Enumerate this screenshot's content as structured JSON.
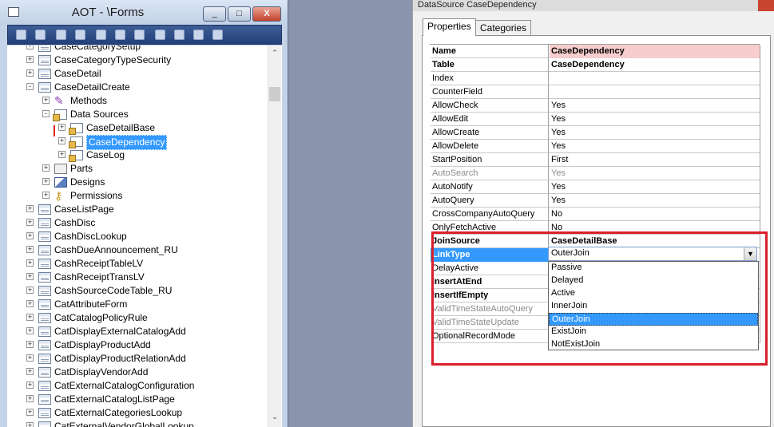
{
  "aot": {
    "title": "AOT - \\Forms",
    "window_buttons": [
      "_",
      "□",
      "X"
    ],
    "tree": [
      {
        "label": "CaseCategorySetup",
        "level": 0,
        "expander": "+",
        "icon": "form-icon",
        "partial": true
      },
      {
        "label": "CaseCategoryTypeSecurity",
        "level": 0,
        "expander": "+",
        "icon": "form-icon"
      },
      {
        "label": "CaseDetail",
        "level": 0,
        "expander": "+",
        "icon": "form-icon"
      },
      {
        "label": "CaseDetailCreate",
        "level": 0,
        "expander": "-",
        "icon": "form-icon"
      },
      {
        "label": "Methods",
        "level": 1,
        "expander": "+",
        "icon": "methods-icon"
      },
      {
        "label": "Data Sources",
        "level": 1,
        "expander": "-",
        "icon": "datasources-icon"
      },
      {
        "label": "CaseDetailBase",
        "level": 2,
        "expander": "+",
        "icon": "datasource-icon"
      },
      {
        "label": "CaseDependency",
        "level": 2,
        "expander": "+",
        "icon": "datasource-icon",
        "selected": true
      },
      {
        "label": "CaseLog",
        "level": 2,
        "expander": "+",
        "icon": "datasource-icon"
      },
      {
        "label": "Parts",
        "level": 1,
        "expander": "+",
        "icon": "parts-icon"
      },
      {
        "label": "Designs",
        "level": 1,
        "expander": "+",
        "icon": "designs-icon"
      },
      {
        "label": "Permissions",
        "level": 1,
        "expander": "+",
        "icon": "permissions-icon"
      },
      {
        "label": "CaseListPage",
        "level": 0,
        "expander": "+",
        "icon": "form-icon"
      },
      {
        "label": "CashDisc",
        "level": 0,
        "expander": "+",
        "icon": "form-icon"
      },
      {
        "label": "CashDiscLookup",
        "level": 0,
        "expander": "+",
        "icon": "form-icon"
      },
      {
        "label": "CashDueAnnouncement_RU",
        "level": 0,
        "expander": "+",
        "icon": "form-icon"
      },
      {
        "label": "CashReceiptTableLV",
        "level": 0,
        "expander": "+",
        "icon": "form-icon"
      },
      {
        "label": "CashReceiptTransLV",
        "level": 0,
        "expander": "+",
        "icon": "form-icon"
      },
      {
        "label": "CashSourceCodeTable_RU",
        "level": 0,
        "expander": "+",
        "icon": "form-icon"
      },
      {
        "label": "CatAttributeForm",
        "level": 0,
        "expander": "+",
        "icon": "form-icon"
      },
      {
        "label": "CatCatalogPolicyRule",
        "level": 0,
        "expander": "+",
        "icon": "form-icon"
      },
      {
        "label": "CatDisplayExternalCatalogAdd",
        "level": 0,
        "expander": "+",
        "icon": "form-icon"
      },
      {
        "label": "CatDisplayProductAdd",
        "level": 0,
        "expander": "+",
        "icon": "form-icon"
      },
      {
        "label": "CatDisplayProductRelationAdd",
        "level": 0,
        "expander": "+",
        "icon": "form-icon"
      },
      {
        "label": "CatDisplayVendorAdd",
        "level": 0,
        "expander": "+",
        "icon": "form-icon"
      },
      {
        "label": "CatExternalCatalogConfiguration",
        "level": 0,
        "expander": "+",
        "icon": "form-icon"
      },
      {
        "label": "CatExternalCatalogListPage",
        "level": 0,
        "expander": "+",
        "icon": "form-icon"
      },
      {
        "label": "CatExternalCategoriesLookup",
        "level": 0,
        "expander": "+",
        "icon": "form-icon"
      },
      {
        "label": "CatExternalVendorGlobalLookup",
        "level": 0,
        "expander": "+",
        "icon": "form-icon",
        "partial": true
      }
    ]
  },
  "props": {
    "title": "DataSource CaseDependency",
    "tabs": [
      "Properties",
      "Categories"
    ],
    "rows": [
      {
        "name": "Name",
        "value": "CaseDependency",
        "bold": true,
        "pink": true
      },
      {
        "name": "Table",
        "value": "CaseDependency",
        "bold": true
      },
      {
        "name": "Index",
        "value": ""
      },
      {
        "name": "CounterField",
        "value": ""
      },
      {
        "name": "AllowCheck",
        "value": "Yes"
      },
      {
        "name": "AllowEdit",
        "value": "Yes"
      },
      {
        "name": "AllowCreate",
        "value": "Yes"
      },
      {
        "name": "AllowDelete",
        "value": "Yes"
      },
      {
        "name": "StartPosition",
        "value": "First"
      },
      {
        "name": "AutoSearch",
        "value": "Yes",
        "dim": true
      },
      {
        "name": "AutoNotify",
        "value": "Yes"
      },
      {
        "name": "AutoQuery",
        "value": "Yes"
      },
      {
        "name": "CrossCompanyAutoQuery",
        "value": "No"
      },
      {
        "name": "OnlyFetchActive",
        "value": "No"
      },
      {
        "name": "JoinSource",
        "value": "CaseDetailBase",
        "bold": true
      },
      {
        "name": "LinkType",
        "value": "",
        "bold": true,
        "selected": true
      },
      {
        "name": "DelayActive",
        "value": ""
      },
      {
        "name": "InsertAtEnd",
        "value": "",
        "bold": true
      },
      {
        "name": "InsertIfEmpty",
        "value": "",
        "bold": true
      },
      {
        "name": "ValidTimeStateAutoQuery",
        "value": "",
        "dim": true
      },
      {
        "name": "ValidTimeStateUpdate",
        "value": "",
        "dim": true
      },
      {
        "name": "OptionalRecordMode",
        "value": ""
      }
    ],
    "linktype_value": "OuterJoin",
    "linktype_options": [
      "Passive",
      "Delayed",
      "Active",
      "InnerJoin",
      "OuterJoin",
      "ExistJoin",
      "NotExistJoin"
    ],
    "linktype_selected": "OuterJoin"
  },
  "colors": {
    "highlight": "#d9202c",
    "selection": "#3399ff",
    "pink": "#f7cdcd"
  }
}
